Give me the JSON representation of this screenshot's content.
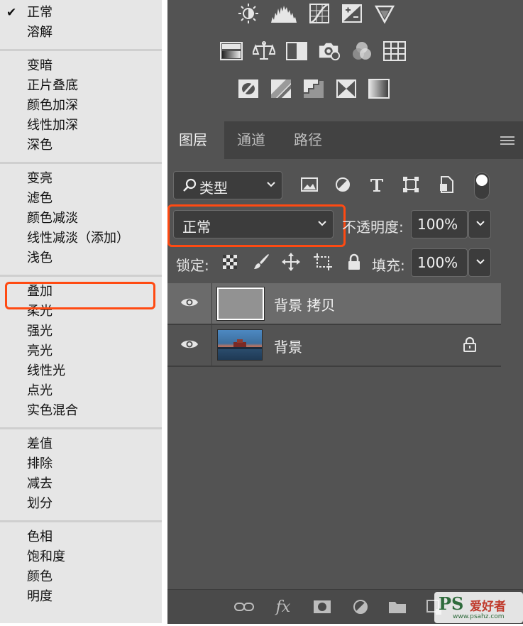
{
  "blend_menu": {
    "groups": [
      [
        "正常",
        "溶解"
      ],
      [
        "变暗",
        "正片叠底",
        "颜色加深",
        "线性加深",
        "深色"
      ],
      [
        "变亮",
        "滤色",
        "颜色减淡",
        "线性减淡（添加）",
        "浅色"
      ],
      [
        "叠加",
        "柔光",
        "强光",
        "亮光",
        "线性光",
        "点光",
        "实色混合"
      ],
      [
        "差值",
        "排除",
        "减去",
        "划分"
      ],
      [
        "色相",
        "饱和度",
        "颜色",
        "明度"
      ]
    ],
    "checked": "正常",
    "highlighted": "叠加",
    "highlight_color": "#ff4a12"
  },
  "adjustments": {
    "row1": [
      "brightness-contrast-icon",
      "levels-icon",
      "curves-icon",
      "exposure-icon",
      "vibrance-icon"
    ],
    "row2": [
      "hue-saturation-icon",
      "color-balance-icon",
      "black-white-icon",
      "photo-filter-icon",
      "channel-mixer-icon",
      "color-lookup-icon"
    ],
    "row3": [
      "invert-icon",
      "posterize-icon",
      "threshold-icon",
      "selective-color-icon",
      "gradient-map-icon"
    ]
  },
  "tabs": [
    {
      "label": "图层",
      "active": true
    },
    {
      "label": "通道",
      "active": false
    },
    {
      "label": "路径",
      "active": false
    }
  ],
  "filter": {
    "kind_label": "类型"
  },
  "blend_mode": {
    "value": "正常"
  },
  "opacity": {
    "label": "不透明度:",
    "value": "100%"
  },
  "lock": {
    "label": "锁定:"
  },
  "fill": {
    "label": "填充:",
    "value": "100%"
  },
  "layers": [
    {
      "name": "背景 拷贝",
      "selected": true,
      "locked": false
    },
    {
      "name": "背景",
      "selected": false,
      "locked": true
    }
  ],
  "watermark": {
    "brand": "PS",
    "cn": "爱好者",
    "url": "www.psahz.com"
  }
}
